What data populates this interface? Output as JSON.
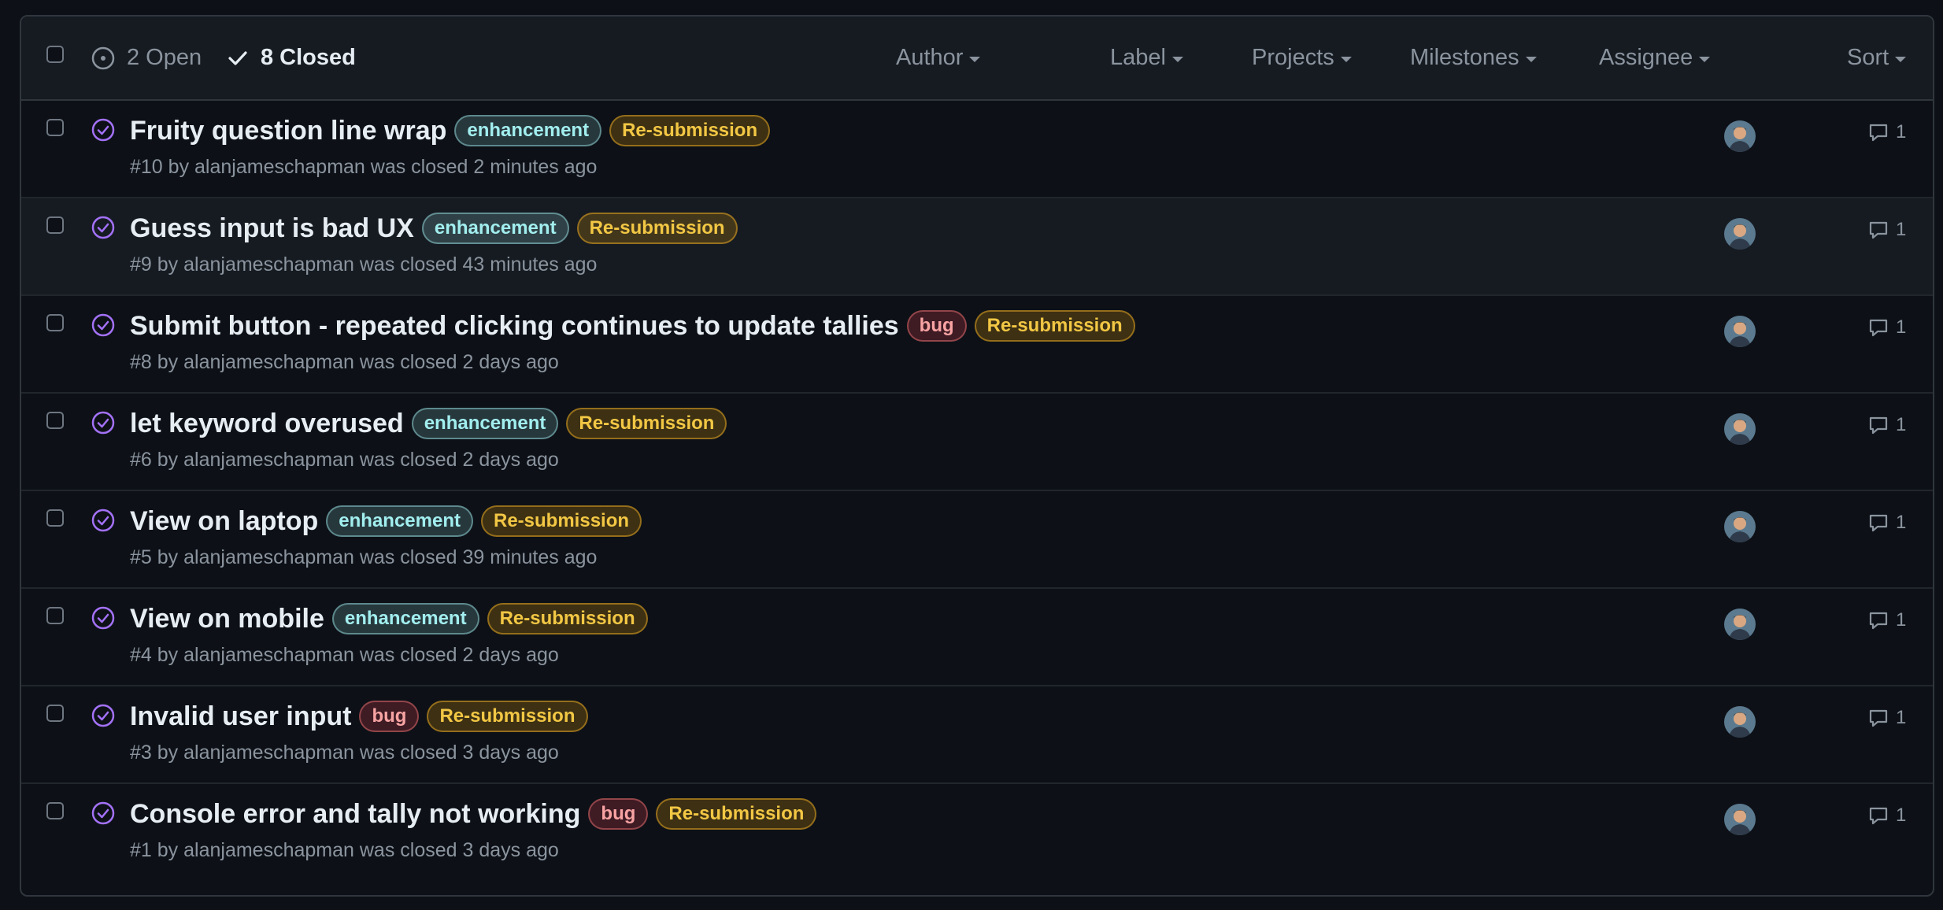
{
  "header": {
    "open_label": "2 Open",
    "closed_label": "8 Closed",
    "filters": {
      "author": "Author",
      "label": "Label",
      "projects": "Projects",
      "milestones": "Milestones",
      "assignee": "Assignee",
      "sort": "Sort"
    }
  },
  "colors": {
    "background": "#0d1117",
    "header_background": "#161b22",
    "closed_icon": "#a371f7",
    "enhancement_label": "#a2eeef",
    "bug_label": "#f8a3a3",
    "resubmission_label": "#f2c744"
  },
  "issues": [
    {
      "title": "Fruity question line wrap",
      "labels": [
        "enhancement",
        "Re-submission"
      ],
      "number": "#10",
      "by": "by",
      "author": "alanjameschapman",
      "closed_text": "was closed 2 minutes ago",
      "comments": "1"
    },
    {
      "title": "Guess input is bad UX",
      "labels": [
        "enhancement",
        "Re-submission"
      ],
      "number": "#9",
      "by": "by",
      "author": "alanjameschapman",
      "closed_text": "was closed 43 minutes ago",
      "comments": "1"
    },
    {
      "title": "Submit button - repeated clicking continues to update tallies",
      "labels": [
        "bug",
        "Re-submission"
      ],
      "number": "#8",
      "by": "by",
      "author": "alanjameschapman",
      "closed_text": "was closed 2 days ago",
      "comments": "1"
    },
    {
      "title": "let keyword overused",
      "labels": [
        "enhancement",
        "Re-submission"
      ],
      "number": "#6",
      "by": "by",
      "author": "alanjameschapman",
      "closed_text": "was closed 2 days ago",
      "comments": "1"
    },
    {
      "title": "View on laptop",
      "labels": [
        "enhancement",
        "Re-submission"
      ],
      "number": "#5",
      "by": "by",
      "author": "alanjameschapman",
      "closed_text": "was closed 39 minutes ago",
      "comments": "1"
    },
    {
      "title": "View on mobile",
      "labels": [
        "enhancement",
        "Re-submission"
      ],
      "number": "#4",
      "by": "by",
      "author": "alanjameschapman",
      "closed_text": "was closed 2 days ago",
      "comments": "1"
    },
    {
      "title": "Invalid user input",
      "labels": [
        "bug",
        "Re-submission"
      ],
      "number": "#3",
      "by": "by",
      "author": "alanjameschapman",
      "closed_text": "was closed 3 days ago",
      "comments": "1"
    },
    {
      "title": "Console error and tally not working",
      "labels": [
        "bug",
        "Re-submission"
      ],
      "number": "#1",
      "by": "by",
      "author": "alanjameschapman",
      "closed_text": "was closed 3 days ago",
      "comments": "1"
    }
  ]
}
